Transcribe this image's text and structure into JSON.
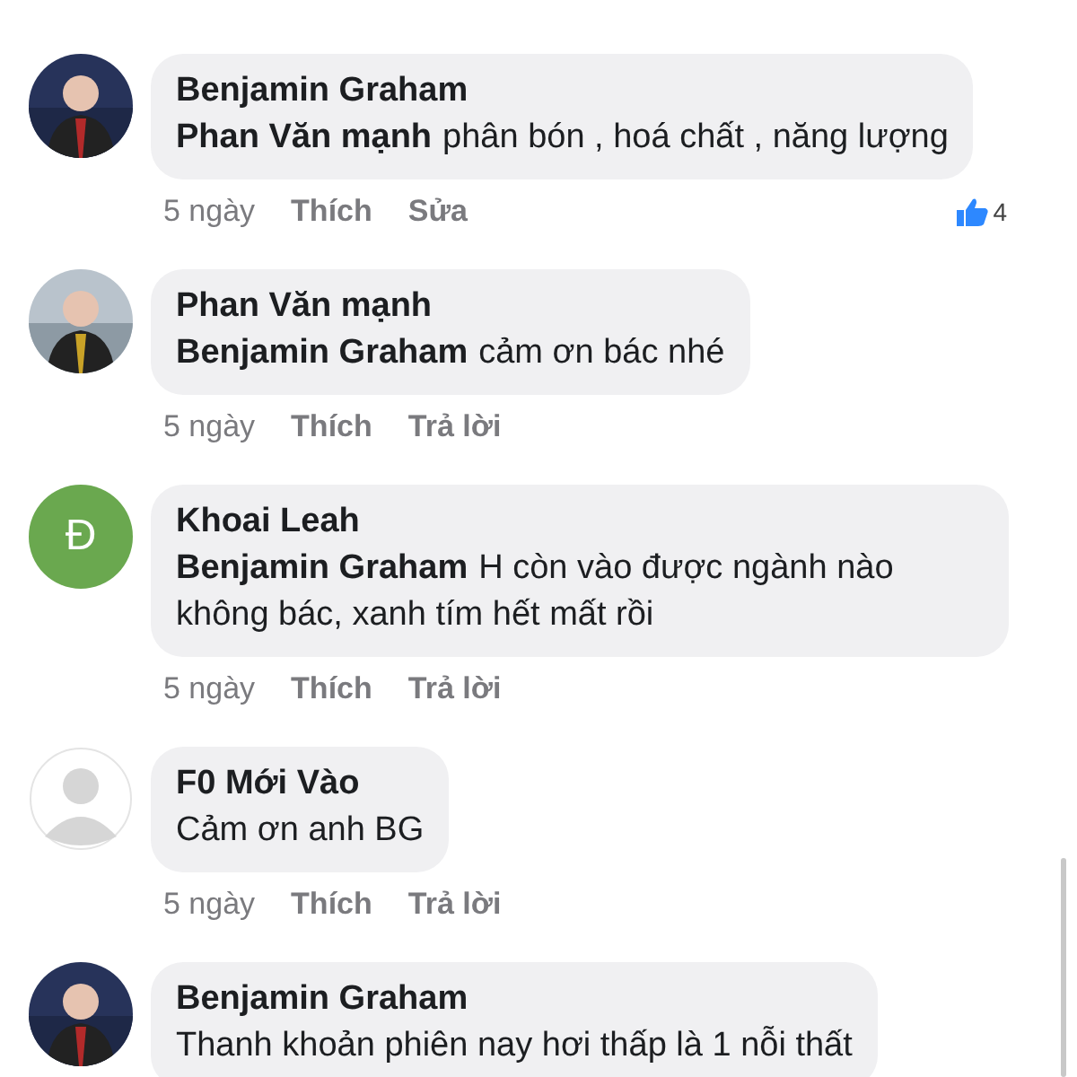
{
  "comments": [
    {
      "author": "Benjamin Graham",
      "mention": "Phan Văn mạnh",
      "text": "phân bón , hoá chất , năng lượng",
      "time": "5 ngày",
      "actions": [
        "Thích",
        "Sửa"
      ],
      "likes": "4"
    },
    {
      "author": "Phan Văn mạnh",
      "mention": "Benjamin Graham",
      "text": "cảm ơn bác nhé",
      "time": "5 ngày",
      "actions": [
        "Thích",
        "Trả lời"
      ]
    },
    {
      "avatar": {
        "kind": "letter",
        "letter": "Đ",
        "color": "#6aa84f"
      },
      "author": "Khoai Leah",
      "mention": "Benjamin Graham",
      "text": "H còn vào được ngành nào không bác, xanh tím hết mất rồi",
      "time": "5 ngày",
      "actions": [
        "Thích",
        "Trả lời"
      ]
    },
    {
      "avatar": {
        "kind": "default"
      },
      "author": "F0 Mới Vào",
      "text": "Cảm ơn anh BG",
      "time": "5 ngày",
      "actions": [
        "Thích",
        "Trả lời"
      ]
    },
    {
      "author": "Benjamin Graham",
      "text": "Thanh khoản phiên nay hơi thấp là 1 nỗi thất"
    }
  ]
}
